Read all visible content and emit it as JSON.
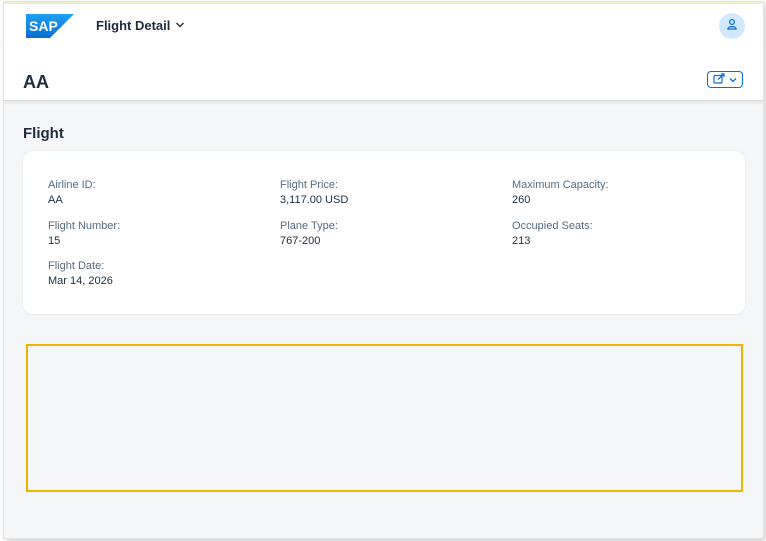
{
  "shell": {
    "logo_text": "SAP",
    "app_title": "Flight Detail",
    "colors": {
      "logo_blue": "#0a6ed1",
      "avatar_bg": "#d1e8ff",
      "accent": "#0a6ed1",
      "highlight": "#f0b400"
    }
  },
  "header": {
    "title": "AA"
  },
  "section": {
    "title": "Flight"
  },
  "fields": {
    "airline_id": {
      "label": "Airline ID:",
      "value": "AA"
    },
    "flight_number": {
      "label": "Flight Number:",
      "value": "15"
    },
    "flight_date": {
      "label": "Flight Date:",
      "value": "Mar 14, 2026"
    },
    "flight_price": {
      "label": "Flight Price:",
      "value": "3,117.00 USD"
    },
    "plane_type": {
      "label": "Plane Type:",
      "value": "767-200"
    },
    "max_capacity": {
      "label": "Maximum Capacity:",
      "value": "260"
    },
    "occupied_seats": {
      "label": "Occupied Seats:",
      "value": "213"
    }
  },
  "icons": {
    "avatar": "user-icon",
    "title_menu": "chevron-down-icon",
    "share": "share-icon"
  }
}
